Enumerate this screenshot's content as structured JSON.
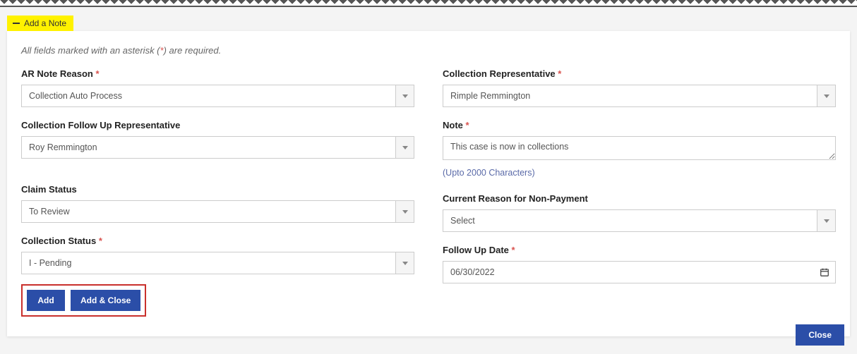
{
  "header": {
    "title": "Add a Note"
  },
  "instructions": {
    "pre": "All fields marked with an asterisk (",
    "ast": "*",
    "post": ") are required."
  },
  "left": {
    "ar_note_reason": {
      "label": "AR Note Reason",
      "value": "Collection Auto Process"
    },
    "follow_up_rep": {
      "label": "Collection Follow Up Representative",
      "value": "Roy Remmington"
    },
    "claim_status": {
      "label": "Claim Status",
      "value": "To Review"
    },
    "coll_status": {
      "label": "Collection Status",
      "value": "I - Pending"
    }
  },
  "right": {
    "coll_rep": {
      "label": "Collection Representative",
      "value": "Rimple Remmington"
    },
    "note": {
      "label": "Note",
      "value": "This case is now in collections",
      "hint": "(Upto 2000 Characters)"
    },
    "reason_nonpay": {
      "label": "Current Reason for Non-Payment",
      "value": "Select"
    },
    "follow_up_date": {
      "label": "Follow Up Date",
      "value": "06/30/2022"
    }
  },
  "buttons": {
    "add": "Add",
    "add_close": "Add & Close",
    "close": "Close"
  }
}
